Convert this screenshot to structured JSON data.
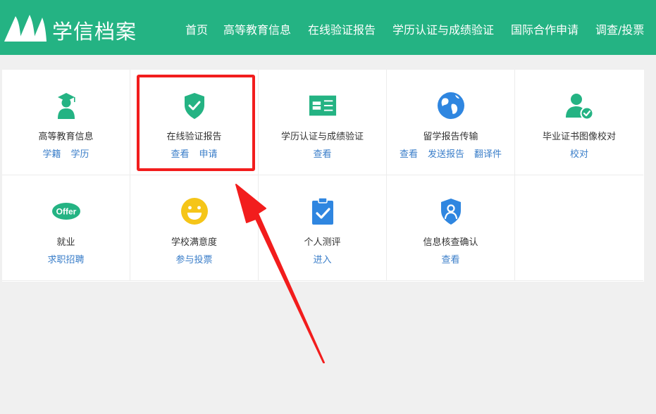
{
  "header": {
    "logo_text": "学信档案",
    "nav": [
      "首页",
      "高等教育信息",
      "在线验证报告",
      "学历认证与成绩验证",
      "国际合作申请",
      "调查/投票"
    ]
  },
  "colors": {
    "brand": "#24b383",
    "link": "#3a7ec9",
    "highlight": "#f21d1d"
  },
  "services": [
    {
      "title": "高等教育信息",
      "icon": "graduate-icon",
      "links": [
        "学籍",
        "学历"
      ]
    },
    {
      "title": "在线验证报告",
      "icon": "shield-check-icon",
      "links": [
        "查看",
        "申请"
      ]
    },
    {
      "title": "学历认证与成绩验证",
      "icon": "id-card-icon",
      "links": [
        "查看"
      ]
    },
    {
      "title": "留学报告传输",
      "icon": "globe-icon",
      "links": [
        "查看",
        "发送报告",
        "翻译件"
      ]
    },
    {
      "title": "毕业证书图像校对",
      "icon": "user-check-icon",
      "links": [
        "校对"
      ]
    },
    {
      "title": "就业",
      "icon": "offer-icon",
      "links": [
        "求职招聘"
      ]
    },
    {
      "title": "学校满意度",
      "icon": "smiley-icon",
      "links": [
        "参与投票"
      ]
    },
    {
      "title": "个人测评",
      "icon": "clipboard-check-icon",
      "links": [
        "进入"
      ]
    },
    {
      "title": "信息核查确认",
      "icon": "shield-user-icon",
      "links": [
        "查看"
      ]
    }
  ]
}
